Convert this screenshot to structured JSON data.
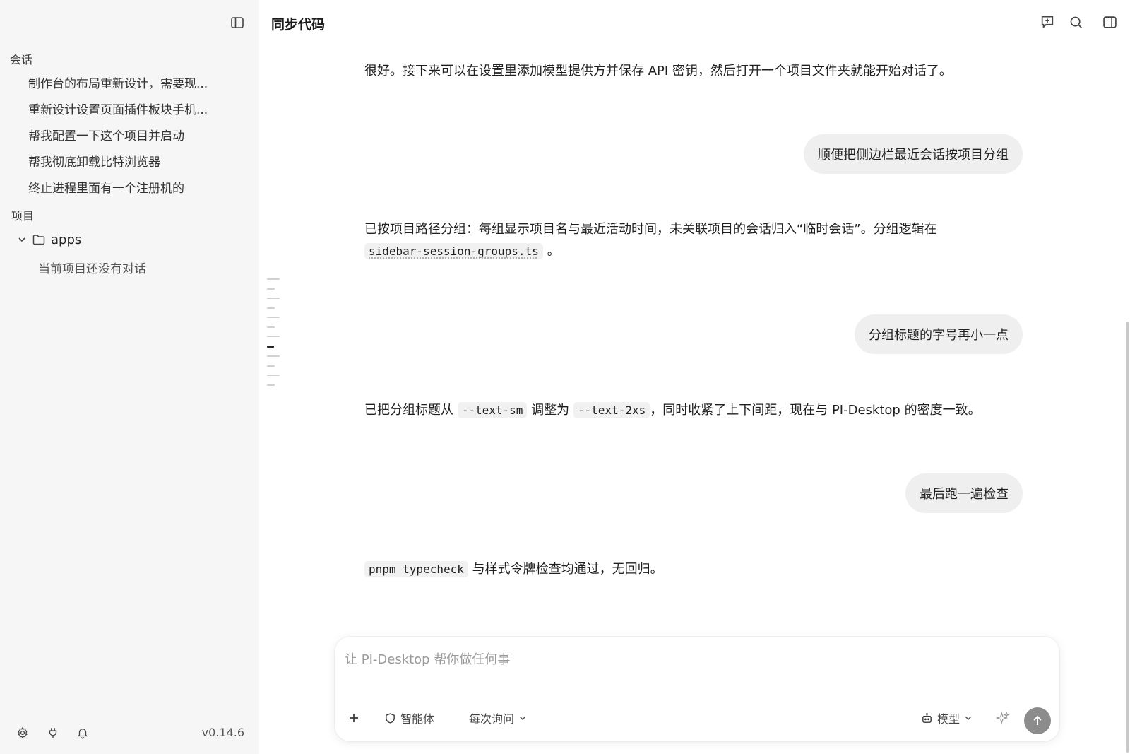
{
  "sidebar": {
    "sessions_title": "会话",
    "sessions": [
      {
        "label": "制作台的布局重新设计，需要现..."
      },
      {
        "label": "重新设计设置页面插件板块手机..."
      },
      {
        "label": "帮我配置一下这个项目并启动"
      },
      {
        "label": "帮我彻底卸载比特浏览器"
      },
      {
        "label": "终止进程里面有一个注册机的"
      }
    ],
    "projects_title": "项目",
    "project": {
      "name": "apps",
      "empty_hint": "当前项目还没有对话"
    },
    "version": "v0.14.6"
  },
  "header": {
    "title": "同步代码"
  },
  "messages": {
    "a1": "很好。接下来可以在设置里添加模型提供方并保存 API 密钥，然后打开一个项目文件夹就能开始对话了。",
    "u1": "顺便把侧边栏最近会话按项目分组",
    "a2_text": "已按项目路径分组：每组显示项目名与最近活动时间，未关联项目的会话归入“临时会话”。分组逻辑在",
    "a2_code": "sidebar-session-groups.ts",
    "a2_end": "。",
    "u2": "分组标题的字号再小一点",
    "a3_pre": "已把分组标题从",
    "a3_code1": "--text-sm",
    "a3_mid": "调整为",
    "a3_code2": "--text-2xs",
    "a3_post": "，同时收紧了上下间距，现在与 PI-Desktop 的密度一致。",
    "u3": "最后跑一遍检查",
    "a4_code": "pnpm typecheck",
    "a4_text": "与样式令牌检查均通过，无回归。"
  },
  "composer": {
    "placeholder": "让 PI-Desktop 帮你做任何事",
    "agent_label": "智能体",
    "approval_label": "每次询问",
    "model_label": "模型"
  },
  "colors": {
    "send_button": "#8c8c8c",
    "sidebar_bg": "#f6f6f6",
    "bubble_bg": "#efefef"
  }
}
